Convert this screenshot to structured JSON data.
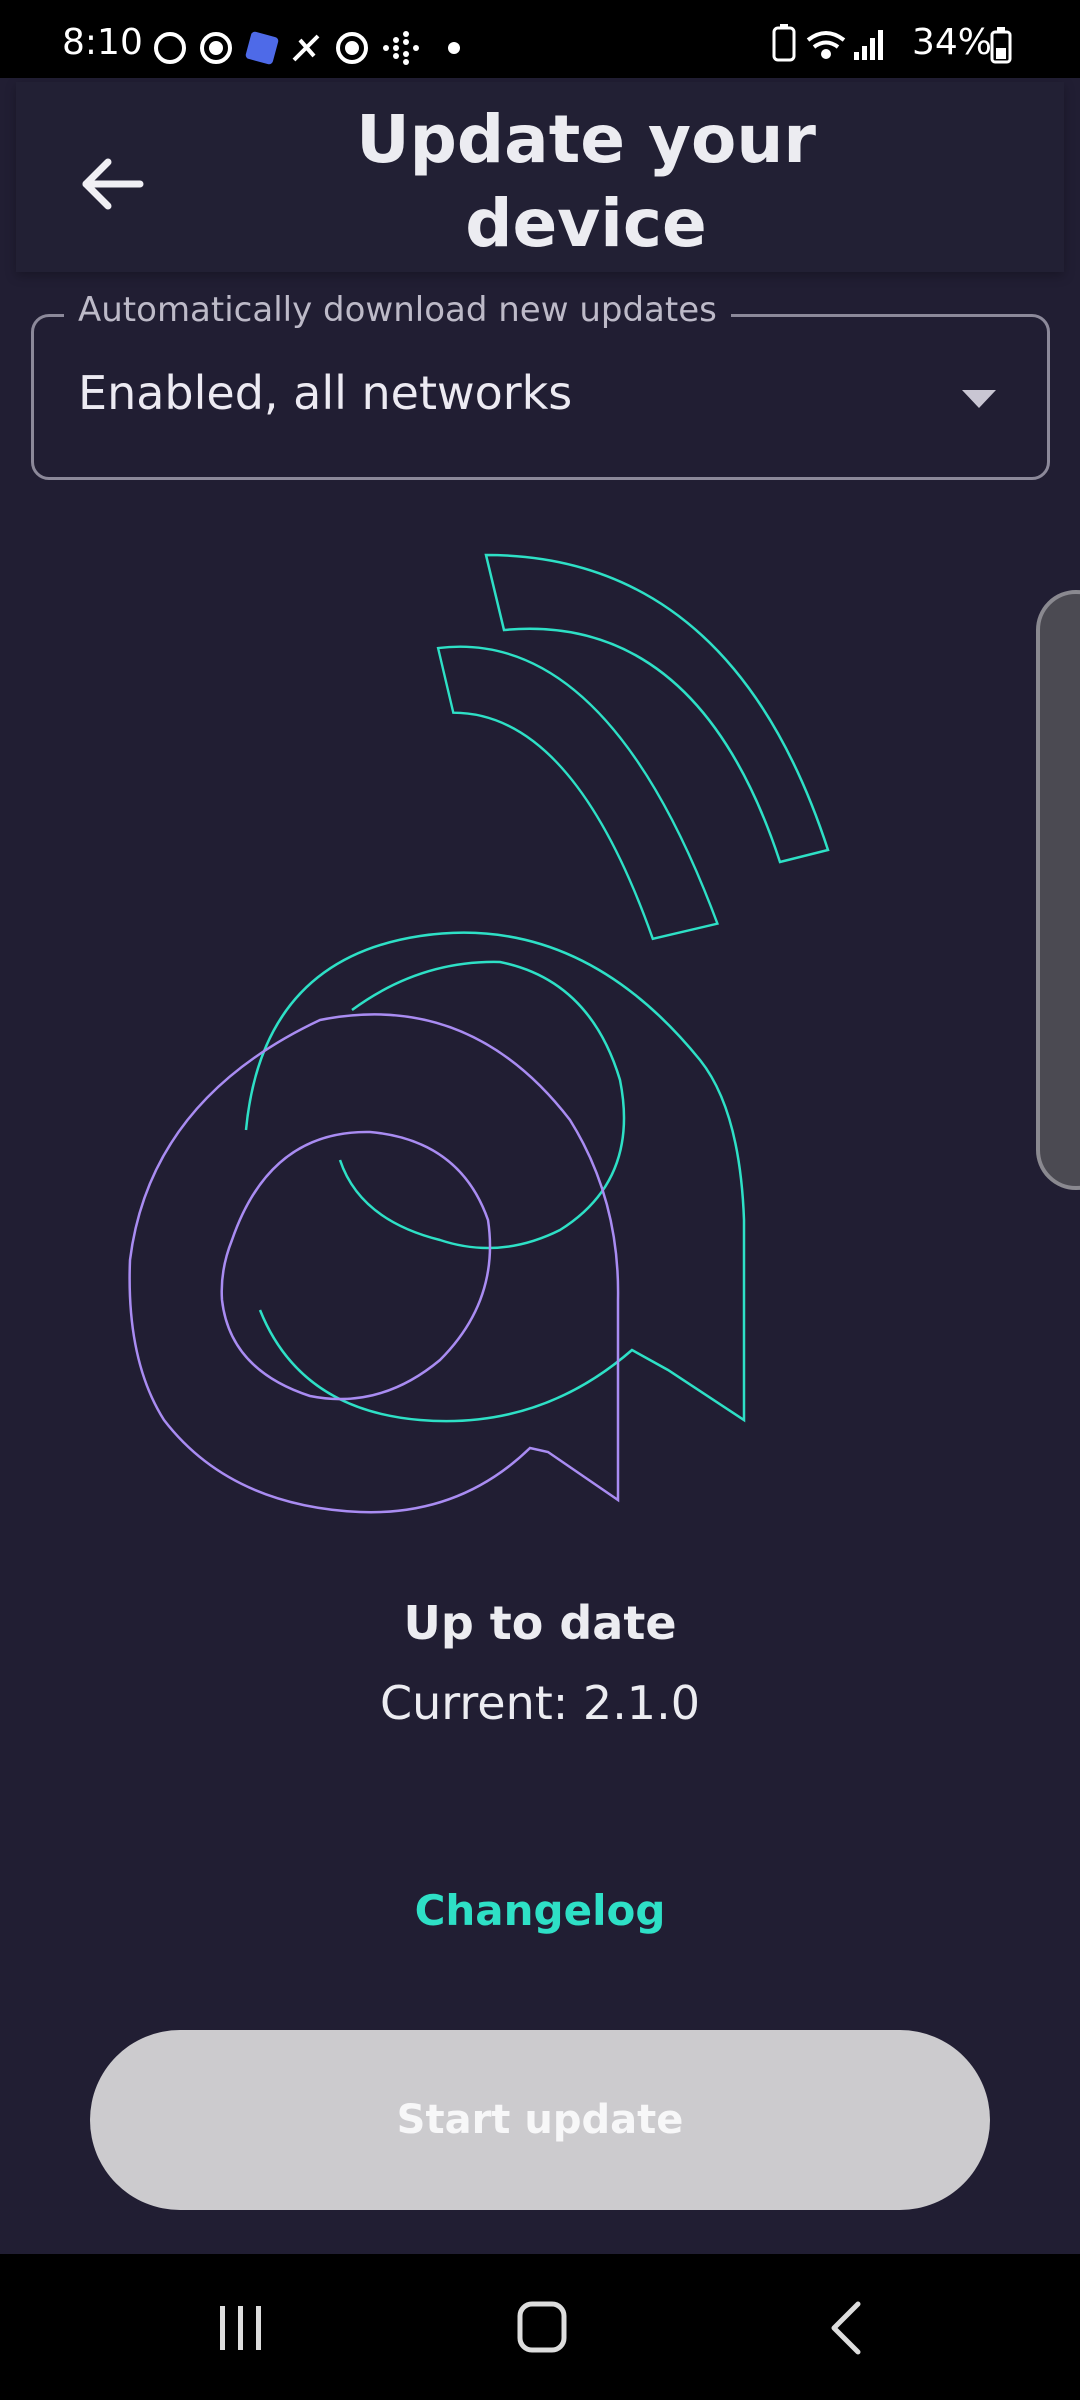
{
  "status_bar": {
    "time": "8:10",
    "battery_percent": "34%",
    "notification_icons": [
      "threads-icon",
      "chrome-icon",
      "puzzle-app-icon",
      "tools-icon",
      "chrome-icon",
      "fitbit-icon",
      "dot-icon"
    ],
    "system_icons": [
      "battery-saver-icon",
      "wifi-icon",
      "signal-icon",
      "battery-icon"
    ]
  },
  "header": {
    "title": "Update your device"
  },
  "auto_download": {
    "label": "Automatically download new updates",
    "value": "Enabled, all networks"
  },
  "update_status": {
    "title": "Up to date",
    "current_version": "Current: 2.1.0"
  },
  "links": {
    "changelog": "Changelog"
  },
  "actions": {
    "start_update": "Start update"
  },
  "colors": {
    "background": "#211e33",
    "accent_teal": "#2ee0c6",
    "accent_purple": "#a98cf2",
    "disabled_button": "#cccbce"
  }
}
